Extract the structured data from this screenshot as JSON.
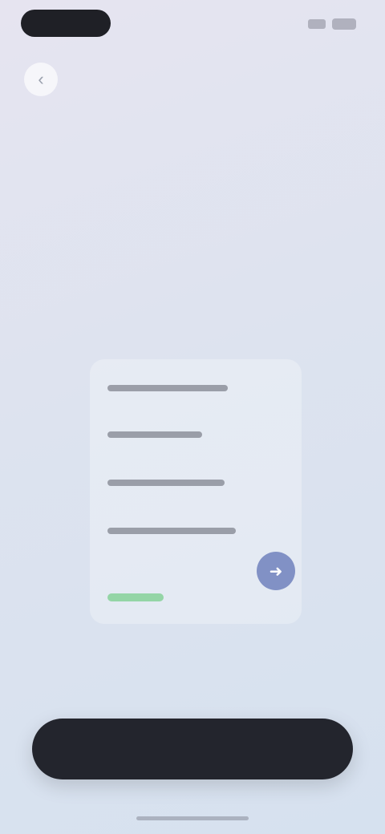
{
  "status_bar": {
    "time": "",
    "icons": [
      "signal-icon",
      "battery-icon"
    ]
  },
  "nav": {
    "back_icon": "chevron-left-icon"
  },
  "header": {
    "title": "",
    "subtitle": ""
  },
  "card": {
    "options": [
      {
        "label": ""
      },
      {
        "label": ""
      },
      {
        "label": ""
      },
      {
        "label": ""
      }
    ],
    "status_color": "#7fcf92",
    "fab_icon": "arrow-icon",
    "fab_color": "#8191c5"
  },
  "footer": {
    "primary_label": "",
    "button_color": "#23252d"
  }
}
